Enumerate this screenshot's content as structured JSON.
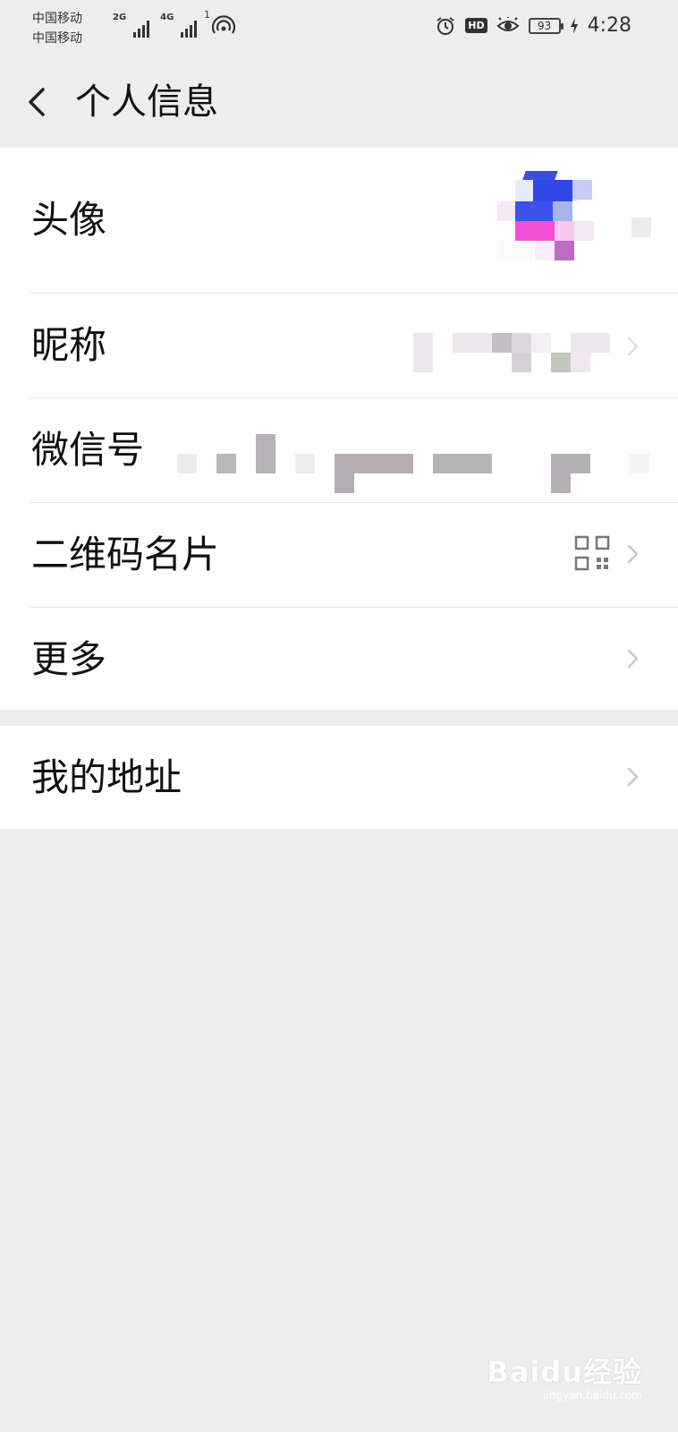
{
  "status_bar": {
    "carrier_1": "中国移动",
    "carrier_2": "中国移动",
    "net_1": "2G",
    "net_2": "4G",
    "hotspot_count": "1",
    "battery": "93",
    "time": "4:28"
  },
  "header": {
    "title": "个人信息"
  },
  "rows": {
    "avatar_label": "头像",
    "nickname_label": "昵称",
    "wechat_id_label": "微信号",
    "qr_label": "二维码名片",
    "more_label": "更多",
    "address_label": "我的地址"
  },
  "watermark": {
    "main": "Baidu经验",
    "sub": "jingyan.baidu.com"
  },
  "colors": {
    "background": "#ededed",
    "card": "#ffffff",
    "text": "#111111",
    "chevron": "#c8c8c8"
  }
}
